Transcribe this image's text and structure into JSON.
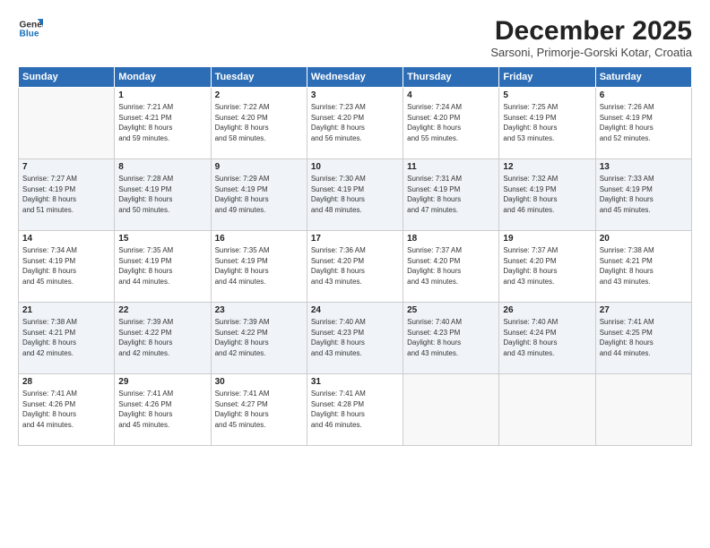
{
  "header": {
    "logo_line1": "General",
    "logo_line2": "Blue",
    "month": "December 2025",
    "location": "Sarsoni, Primorje-Gorski Kotar, Croatia"
  },
  "days_of_week": [
    "Sunday",
    "Monday",
    "Tuesday",
    "Wednesday",
    "Thursday",
    "Friday",
    "Saturday"
  ],
  "weeks": [
    [
      {
        "day": "",
        "sunrise": "",
        "sunset": "",
        "daylight": ""
      },
      {
        "day": "1",
        "sunrise": "Sunrise: 7:21 AM",
        "sunset": "Sunset: 4:21 PM",
        "daylight": "Daylight: 8 hours and 59 minutes."
      },
      {
        "day": "2",
        "sunrise": "Sunrise: 7:22 AM",
        "sunset": "Sunset: 4:20 PM",
        "daylight": "Daylight: 8 hours and 58 minutes."
      },
      {
        "day": "3",
        "sunrise": "Sunrise: 7:23 AM",
        "sunset": "Sunset: 4:20 PM",
        "daylight": "Daylight: 8 hours and 56 minutes."
      },
      {
        "day": "4",
        "sunrise": "Sunrise: 7:24 AM",
        "sunset": "Sunset: 4:20 PM",
        "daylight": "Daylight: 8 hours and 55 minutes."
      },
      {
        "day": "5",
        "sunrise": "Sunrise: 7:25 AM",
        "sunset": "Sunset: 4:19 PM",
        "daylight": "Daylight: 8 hours and 53 minutes."
      },
      {
        "day": "6",
        "sunrise": "Sunrise: 7:26 AM",
        "sunset": "Sunset: 4:19 PM",
        "daylight": "Daylight: 8 hours and 52 minutes."
      }
    ],
    [
      {
        "day": "7",
        "sunrise": "Sunrise: 7:27 AM",
        "sunset": "Sunset: 4:19 PM",
        "daylight": "Daylight: 8 hours and 51 minutes."
      },
      {
        "day": "8",
        "sunrise": "Sunrise: 7:28 AM",
        "sunset": "Sunset: 4:19 PM",
        "daylight": "Daylight: 8 hours and 50 minutes."
      },
      {
        "day": "9",
        "sunrise": "Sunrise: 7:29 AM",
        "sunset": "Sunset: 4:19 PM",
        "daylight": "Daylight: 8 hours and 49 minutes."
      },
      {
        "day": "10",
        "sunrise": "Sunrise: 7:30 AM",
        "sunset": "Sunset: 4:19 PM",
        "daylight": "Daylight: 8 hours and 48 minutes."
      },
      {
        "day": "11",
        "sunrise": "Sunrise: 7:31 AM",
        "sunset": "Sunset: 4:19 PM",
        "daylight": "Daylight: 8 hours and 47 minutes."
      },
      {
        "day": "12",
        "sunrise": "Sunrise: 7:32 AM",
        "sunset": "Sunset: 4:19 PM",
        "daylight": "Daylight: 8 hours and 46 minutes."
      },
      {
        "day": "13",
        "sunrise": "Sunrise: 7:33 AM",
        "sunset": "Sunset: 4:19 PM",
        "daylight": "Daylight: 8 hours and 45 minutes."
      }
    ],
    [
      {
        "day": "14",
        "sunrise": "Sunrise: 7:34 AM",
        "sunset": "Sunset: 4:19 PM",
        "daylight": "Daylight: 8 hours and 45 minutes."
      },
      {
        "day": "15",
        "sunrise": "Sunrise: 7:35 AM",
        "sunset": "Sunset: 4:19 PM",
        "daylight": "Daylight: 8 hours and 44 minutes."
      },
      {
        "day": "16",
        "sunrise": "Sunrise: 7:35 AM",
        "sunset": "Sunset: 4:19 PM",
        "daylight": "Daylight: 8 hours and 44 minutes."
      },
      {
        "day": "17",
        "sunrise": "Sunrise: 7:36 AM",
        "sunset": "Sunset: 4:20 PM",
        "daylight": "Daylight: 8 hours and 43 minutes."
      },
      {
        "day": "18",
        "sunrise": "Sunrise: 7:37 AM",
        "sunset": "Sunset: 4:20 PM",
        "daylight": "Daylight: 8 hours and 43 minutes."
      },
      {
        "day": "19",
        "sunrise": "Sunrise: 7:37 AM",
        "sunset": "Sunset: 4:20 PM",
        "daylight": "Daylight: 8 hours and 43 minutes."
      },
      {
        "day": "20",
        "sunrise": "Sunrise: 7:38 AM",
        "sunset": "Sunset: 4:21 PM",
        "daylight": "Daylight: 8 hours and 43 minutes."
      }
    ],
    [
      {
        "day": "21",
        "sunrise": "Sunrise: 7:38 AM",
        "sunset": "Sunset: 4:21 PM",
        "daylight": "Daylight: 8 hours and 42 minutes."
      },
      {
        "day": "22",
        "sunrise": "Sunrise: 7:39 AM",
        "sunset": "Sunset: 4:22 PM",
        "daylight": "Daylight: 8 hours and 42 minutes."
      },
      {
        "day": "23",
        "sunrise": "Sunrise: 7:39 AM",
        "sunset": "Sunset: 4:22 PM",
        "daylight": "Daylight: 8 hours and 42 minutes."
      },
      {
        "day": "24",
        "sunrise": "Sunrise: 7:40 AM",
        "sunset": "Sunset: 4:23 PM",
        "daylight": "Daylight: 8 hours and 43 minutes."
      },
      {
        "day": "25",
        "sunrise": "Sunrise: 7:40 AM",
        "sunset": "Sunset: 4:23 PM",
        "daylight": "Daylight: 8 hours and 43 minutes."
      },
      {
        "day": "26",
        "sunrise": "Sunrise: 7:40 AM",
        "sunset": "Sunset: 4:24 PM",
        "daylight": "Daylight: 8 hours and 43 minutes."
      },
      {
        "day": "27",
        "sunrise": "Sunrise: 7:41 AM",
        "sunset": "Sunset: 4:25 PM",
        "daylight": "Daylight: 8 hours and 44 minutes."
      }
    ],
    [
      {
        "day": "28",
        "sunrise": "Sunrise: 7:41 AM",
        "sunset": "Sunset: 4:26 PM",
        "daylight": "Daylight: 8 hours and 44 minutes."
      },
      {
        "day": "29",
        "sunrise": "Sunrise: 7:41 AM",
        "sunset": "Sunset: 4:26 PM",
        "daylight": "Daylight: 8 hours and 45 minutes."
      },
      {
        "day": "30",
        "sunrise": "Sunrise: 7:41 AM",
        "sunset": "Sunset: 4:27 PM",
        "daylight": "Daylight: 8 hours and 45 minutes."
      },
      {
        "day": "31",
        "sunrise": "Sunrise: 7:41 AM",
        "sunset": "Sunset: 4:28 PM",
        "daylight": "Daylight: 8 hours and 46 minutes."
      },
      {
        "day": "",
        "sunrise": "",
        "sunset": "",
        "daylight": ""
      },
      {
        "day": "",
        "sunrise": "",
        "sunset": "",
        "daylight": ""
      },
      {
        "day": "",
        "sunrise": "",
        "sunset": "",
        "daylight": ""
      }
    ]
  ]
}
